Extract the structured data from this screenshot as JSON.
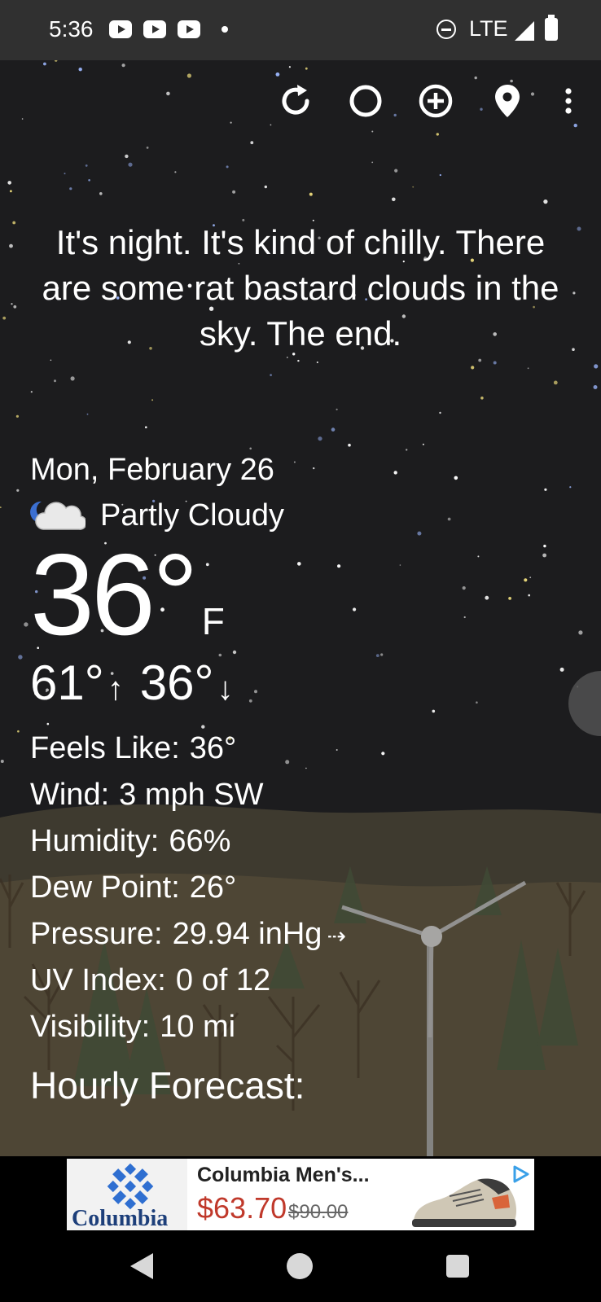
{
  "status_bar": {
    "time": "5:36",
    "notification_icons": [
      "youtube-icon",
      "youtube-icon",
      "youtube-icon"
    ],
    "network": "LTE",
    "icons": [
      "do-not-disturb-icon",
      "signal-icon",
      "battery-icon"
    ]
  },
  "toolbar": {
    "buttons": [
      "refresh-icon",
      "moon-phase-icon",
      "add-location-icon",
      "location-pin-icon",
      "more-vert-icon"
    ]
  },
  "tagline": "It's night. It's kind of chilly. There are some rat bastard clouds in the sky. The end.",
  "weather": {
    "date": "Mon, February 26",
    "condition_icon": "partly-cloudy-night-icon",
    "condition": "Partly Cloudy",
    "temp": "36°",
    "unit": "F",
    "high": "61°",
    "low": "36°",
    "details": [
      {
        "label": "Feels Like:",
        "value": "36°"
      },
      {
        "label": "Wind:",
        "value": "3 mph SW"
      },
      {
        "label": "Humidity:",
        "value": "66%"
      },
      {
        "label": "Dew Point:",
        "value": "26°"
      },
      {
        "label": "Pressure:",
        "value": "29.94 inHg"
      },
      {
        "label": "UV Index:",
        "value": "0 of 12"
      },
      {
        "label": "Visibility:",
        "value": "10 mi"
      }
    ],
    "pressure_trend_icon": "steady-arrow-icon"
  },
  "hourly_heading": "Hourly Forecast:",
  "ad": {
    "brand": "Columbia",
    "title": "Columbia Men's...",
    "price": "$63.70",
    "old_price": "$90.00"
  },
  "colors": {
    "background": "#1c1c1e",
    "status_bar": "#303030",
    "ad_price": "#c0392b",
    "ground": "#4a4436"
  }
}
